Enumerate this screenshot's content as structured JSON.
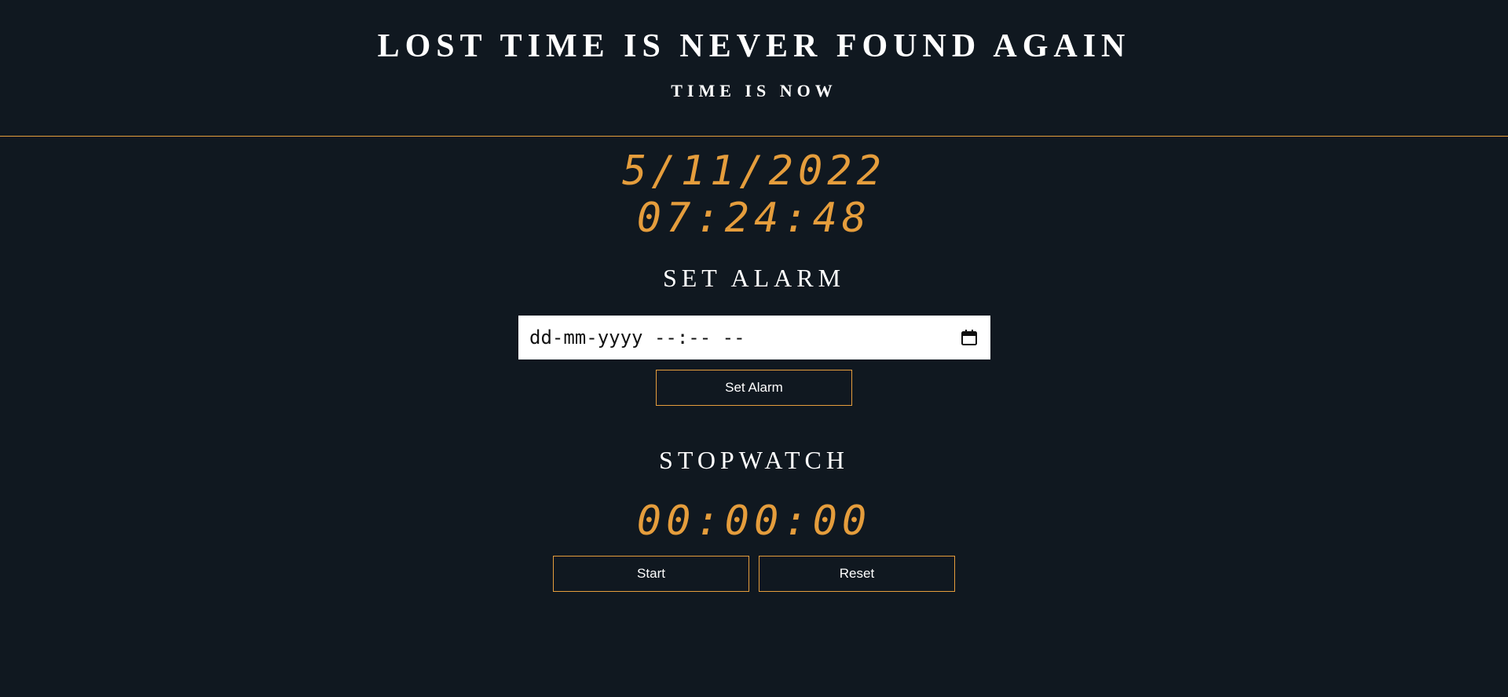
{
  "header": {
    "title": "LOST TIME IS NEVER FOUND AGAIN",
    "subtitle": "TIME IS NOW"
  },
  "clock": {
    "date": "5/11/2022",
    "time": "07:24:48"
  },
  "alarm": {
    "heading": "SET ALARM",
    "input_placeholder": "dd-mm-yyyy --:-- --",
    "input_value": "",
    "calendar_icon": "calendar-icon",
    "set_button_label": "Set Alarm"
  },
  "stopwatch": {
    "heading": "STOPWATCH",
    "display": "00:00:00",
    "start_label": "Start",
    "reset_label": "Reset"
  },
  "colors": {
    "background": "#101820",
    "accent": "#e59d3c",
    "text": "#ffffff"
  }
}
